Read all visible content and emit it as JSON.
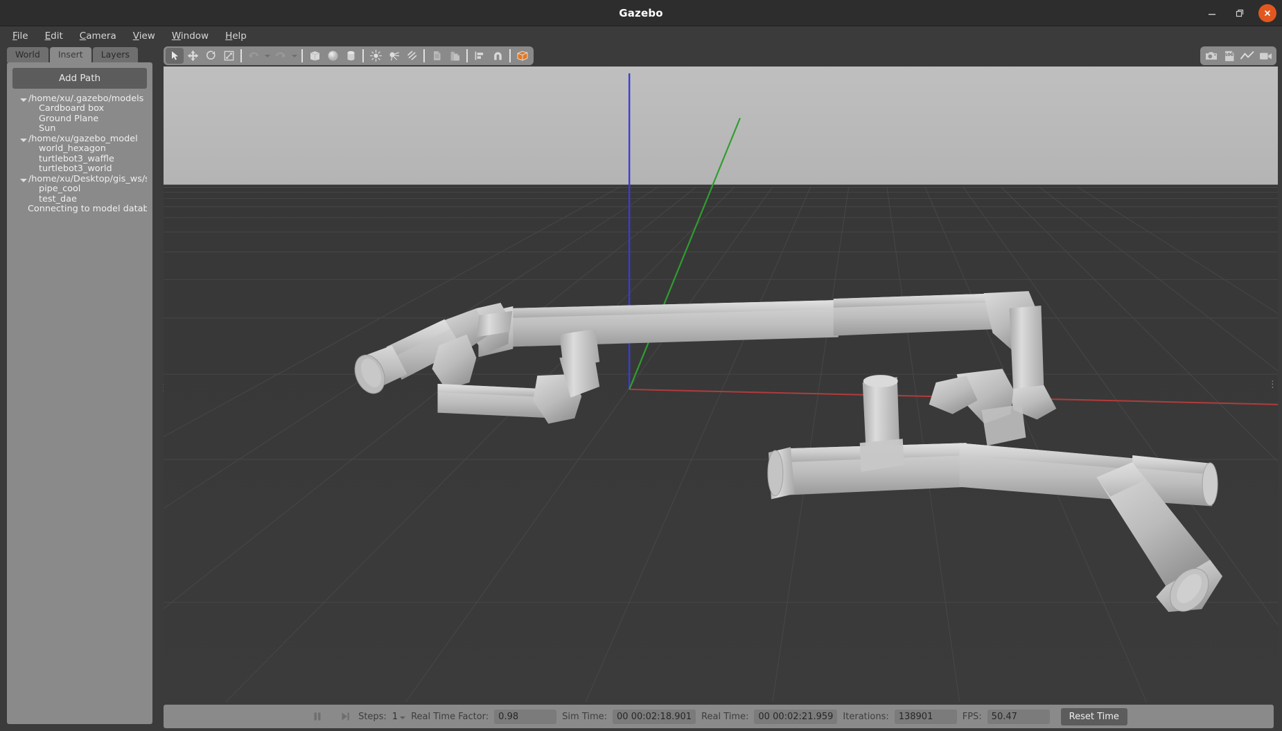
{
  "window": {
    "title": "Gazebo",
    "minimize_label": "—",
    "maximize_label": "❐",
    "close_label": "✕"
  },
  "menubar": {
    "items": [
      {
        "label": "File",
        "mnemonic": "F"
      },
      {
        "label": "Edit",
        "mnemonic": "E"
      },
      {
        "label": "Camera",
        "mnemonic": "C"
      },
      {
        "label": "View",
        "mnemonic": "V"
      },
      {
        "label": "Window",
        "mnemonic": "W"
      },
      {
        "label": "Help",
        "mnemonic": "H"
      }
    ]
  },
  "sidebar": {
    "tabs": [
      {
        "label": "World",
        "active": false
      },
      {
        "label": "Insert",
        "active": true
      },
      {
        "label": "Layers",
        "active": false
      }
    ],
    "add_path_label": "Add Path",
    "tree": [
      {
        "label": "/home/xu/.gazebo/models",
        "type": "group"
      },
      {
        "label": "Cardboard box",
        "type": "child"
      },
      {
        "label": "Ground Plane",
        "type": "child"
      },
      {
        "label": "Sun",
        "type": "child"
      },
      {
        "label": "/home/xu/gazebo_model",
        "type": "group"
      },
      {
        "label": "world_hexagon",
        "type": "child"
      },
      {
        "label": "turtlebot3_waffle",
        "type": "child"
      },
      {
        "label": "turtlebot3_world",
        "type": "child"
      },
      {
        "label": "/home/xu/Desktop/gis_ws/s...",
        "type": "group"
      },
      {
        "label": "pipe_cool",
        "type": "child"
      },
      {
        "label": "test_dae",
        "type": "child"
      },
      {
        "label": "Connecting to model databa...",
        "type": "note"
      }
    ]
  },
  "toolbar": {
    "left_items": [
      {
        "name": "select-mode",
        "icon": "cursor-arrow-icon",
        "active": true
      },
      {
        "name": "translate-mode",
        "icon": "move-arrows-icon",
        "active": false
      },
      {
        "name": "rotate-mode",
        "icon": "rotate-icon",
        "active": false
      },
      {
        "name": "scale-mode",
        "icon": "scale-icon",
        "active": false
      },
      {
        "name": "undo",
        "icon": "undo-arrow-icon",
        "active": false
      },
      {
        "name": "undo-history",
        "icon": "chevron-down-icon",
        "active": false
      },
      {
        "name": "redo",
        "icon": "redo-arrow-icon",
        "active": false
      },
      {
        "name": "redo-history",
        "icon": "chevron-down-icon",
        "active": false
      },
      {
        "name": "insert-box",
        "icon": "box-icon",
        "active": false
      },
      {
        "name": "insert-sphere",
        "icon": "sphere-icon",
        "active": false
      },
      {
        "name": "insert-cylinder",
        "icon": "cylinder-icon",
        "active": false
      },
      {
        "name": "insert-point-light",
        "icon": "point-light-icon",
        "active": false
      },
      {
        "name": "insert-spot-light",
        "icon": "spot-light-icon",
        "active": false
      },
      {
        "name": "insert-directional-light",
        "icon": "directional-light-icon",
        "active": false
      },
      {
        "name": "copy",
        "icon": "copy-icon",
        "active": false
      },
      {
        "name": "paste",
        "icon": "paste-icon",
        "active": false
      },
      {
        "name": "align",
        "icon": "align-icon",
        "active": false
      },
      {
        "name": "snap",
        "icon": "magnet-snap-icon",
        "active": false
      },
      {
        "name": "view-angle",
        "icon": "orange-cube-icon",
        "active": false
      }
    ],
    "right_items": [
      {
        "name": "screenshot",
        "icon": "camera-icon"
      },
      {
        "name": "log-data",
        "icon": "log-file-icon"
      },
      {
        "name": "plot-window",
        "icon": "line-plot-icon"
      },
      {
        "name": "record-video",
        "icon": "video-camera-icon"
      }
    ]
  },
  "statusbar": {
    "play_pause_icon": "pause-icon",
    "step_icon": "step-forward-icon",
    "steps_label": "Steps:",
    "steps_value": "1",
    "real_time_factor_label": "Real Time Factor:",
    "real_time_factor_value": "0.98",
    "sim_time_label": "Sim Time:",
    "sim_time_value": "00 00:02:18.901",
    "real_time_label": "Real Time:",
    "real_time_value": "00 00:02:21.959",
    "iterations_label": "Iterations:",
    "iterations_value": "138901",
    "fps_label": "FPS:",
    "fps_value": "50.47",
    "reset_time_label": "Reset Time"
  },
  "colors": {
    "accent_orange": "#e2571f",
    "panel_grey": "#8a8a8a",
    "window_dark": "#2d2d2d",
    "sky": "#bdbdbd",
    "ground": "#3a3a3a",
    "axis_x": "#b33b3b",
    "axis_y": "#2f9e2f",
    "axis_z": "#3a3ad0",
    "model_grey": "#c9c9c9"
  }
}
